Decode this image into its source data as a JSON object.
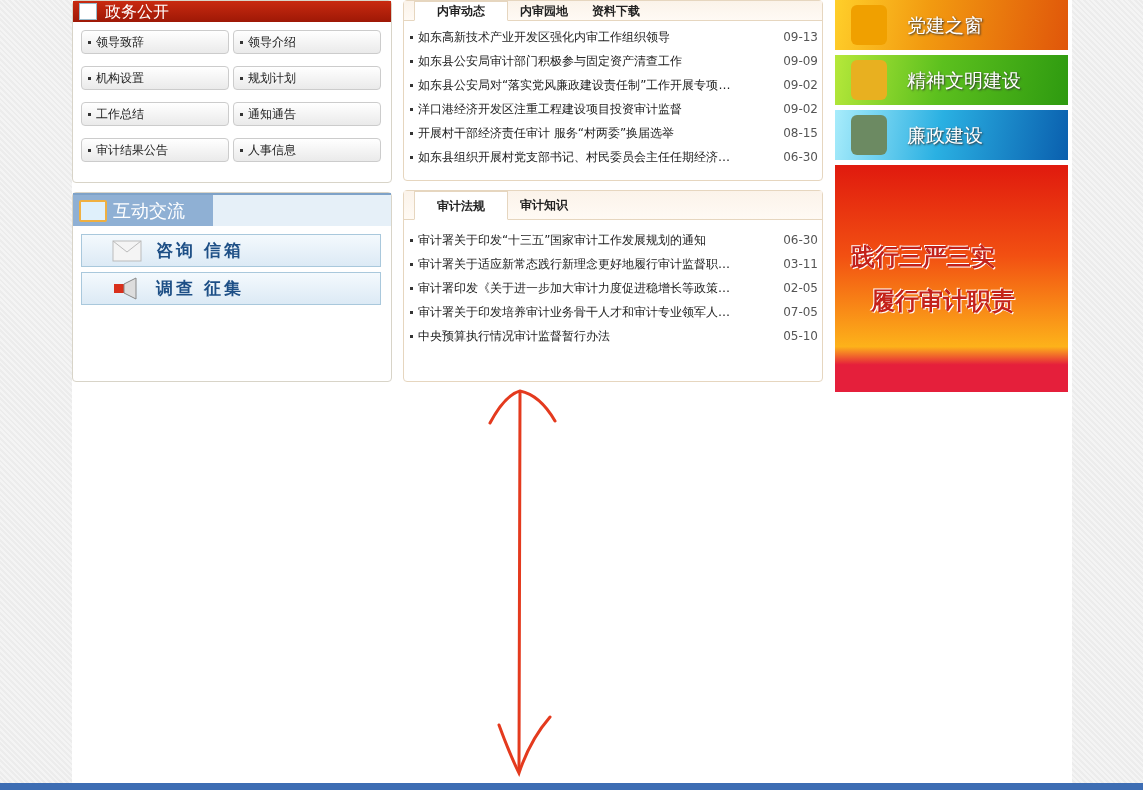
{
  "gov_panel": {
    "title": "政务公开",
    "links": [
      "领导致辞",
      "领导介绍",
      "机构设置",
      "规划计划",
      "工作总结",
      "通知通告",
      "审计结果公告",
      "人事信息"
    ]
  },
  "interact_panel": {
    "title": "互动交流",
    "buttons": [
      {
        "label": "咨询 信箱",
        "kind": "mail"
      },
      {
        "label": "调查 征集",
        "kind": "megaphone"
      }
    ]
  },
  "news_panels": [
    {
      "tabs": [
        {
          "label": "内审动态",
          "selected": true
        },
        {
          "label": "内审园地",
          "selected": false
        },
        {
          "label": "资料下载",
          "selected": false
        }
      ],
      "items": [
        {
          "title": "如东高新技术产业开发区强化内审工作组织领导",
          "date": "09-13"
        },
        {
          "title": "如东县公安局审计部门积极参与固定资产清查工作",
          "date": "09-09"
        },
        {
          "title": "如东县公安局对“落实党风廉政建设责任制”工作开展专项…",
          "date": "09-02"
        },
        {
          "title": "洋口港经济开发区注重工程建设项目投资审计监督",
          "date": "09-02"
        },
        {
          "title": "开展村干部经济责任审计 服务“村两委”换届选举",
          "date": "08-15"
        },
        {
          "title": "如东县组织开展村党支部书记、村民委员会主任任期经济…",
          "date": "06-30"
        }
      ]
    },
    {
      "tabs": [
        {
          "label": "审计法规",
          "selected": true
        },
        {
          "label": "审计知识",
          "selected": false
        }
      ],
      "items": [
        {
          "title": "审计署关于印发“十三五”国家审计工作发展规划的通知",
          "date": "06-30"
        },
        {
          "title": "审计署关于适应新常态践行新理念更好地履行审计监督职…",
          "date": "03-11"
        },
        {
          "title": "审计署印发《关于进一步加大审计力度促进稳增长等政策…",
          "date": "02-05"
        },
        {
          "title": "审计署关于印发培养审计业务骨干人才和审计专业领军人…",
          "date": "07-05"
        },
        {
          "title": "中央预算执行情况审计监督暂行办法",
          "date": "05-10"
        }
      ]
    }
  ],
  "banners": [
    {
      "kind": "party",
      "lines": [
        "党建之窗"
      ]
    },
    {
      "kind": "civility",
      "lines": [
        "精神文明建设"
      ]
    },
    {
      "kind": "integrity",
      "lines": [
        "廉政建设"
      ]
    },
    {
      "kind": "poster",
      "lines": [
        "践行三严三实",
        "履行审计职责"
      ]
    }
  ]
}
